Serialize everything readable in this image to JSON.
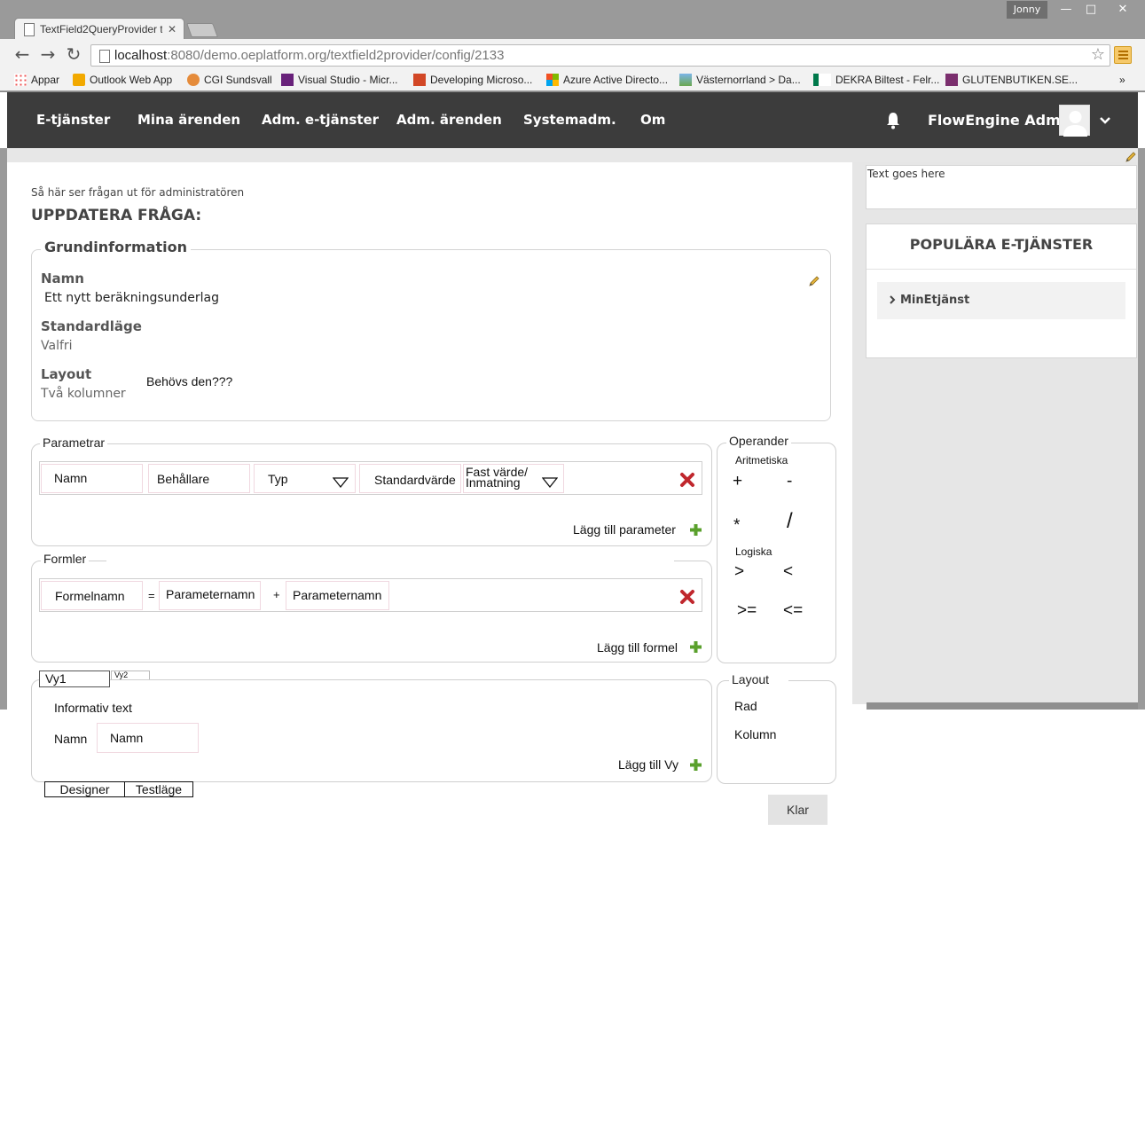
{
  "browser": {
    "user": "Jonny",
    "tab_title": "TextField2QueryProvider t",
    "url_host": "localhost",
    "url_rest": ":8080/demo.oeplatform.org/textfield2provider/config/2133",
    "bookmarks": [
      "Appar",
      "Outlook Web App",
      "CGI Sundsvall",
      "Visual Studio - Micr...",
      "Developing Microso...",
      "Azure Active Directo...",
      "Västernorrland > Da...",
      "DEKRA Biltest - Felr...",
      "GLUTENBUTIKEN.SE..."
    ],
    "more": "»"
  },
  "nav": {
    "items": [
      "E-tjänster",
      "Mina ärenden",
      "Adm. e-tjänster",
      "Adm. ärenden",
      "Systemadm.",
      "Om"
    ],
    "user_name": "FlowEngine Admin"
  },
  "sidebar": {
    "text_box": "Text goes here",
    "popular_title": "POPULÄRA E-TJÄNSTER",
    "popular_items": [
      "MinEtjänst"
    ]
  },
  "page": {
    "admin_note": "Så här ser frågan ut för administratören",
    "title": "UPPDATERA FRÅGA:"
  },
  "grund": {
    "legend": "Grundinformation",
    "name_label": "Namn",
    "name_value": "Ett nytt beräkningsunderlag",
    "std_label": "Standardläge",
    "std_value": "Valfri",
    "layout_label": "Layout",
    "layout_value": "Två kolumner",
    "layout_note": "Behövs den???"
  },
  "params": {
    "legend": "Parametrar",
    "cells": [
      "Namn",
      "Behållare",
      "Typ",
      "Standardvärde"
    ],
    "fixed_line1": "Fast värde/",
    "fixed_line2": "Inmatning",
    "add_label": "Lägg till parameter"
  },
  "formulas": {
    "legend": "Formler",
    "formula_name": "Formelnamn",
    "eq": "=",
    "param1": "Parameternamn",
    "plus": "+",
    "param2": "Parameternamn",
    "add_label": "Lägg till formel"
  },
  "operands": {
    "legend": "Operander",
    "arith_label": "Aritmetiska",
    "arith": [
      "+",
      "-",
      "*",
      "/"
    ],
    "logic_label": "Logiska",
    "logic": [
      ">",
      "<",
      ">=",
      "<="
    ]
  },
  "views": {
    "tab1": "Vy1",
    "tab2": "Vy2",
    "info": "Informativ text",
    "name_label": "Namn",
    "name_cell": "Namn",
    "add_label": "Lägg till Vy"
  },
  "layout_box": {
    "legend": "Layout",
    "options": [
      "Rad",
      "Kolumn"
    ]
  },
  "mode_tabs": [
    "Designer",
    "Testläge"
  ],
  "done_button": "Klar",
  "colors": {
    "nav_bg": "#3c3c3c",
    "sidebar_bg": "#e6e6e6",
    "delete_red": "#c0272d",
    "add_green": "#5aa02c"
  }
}
